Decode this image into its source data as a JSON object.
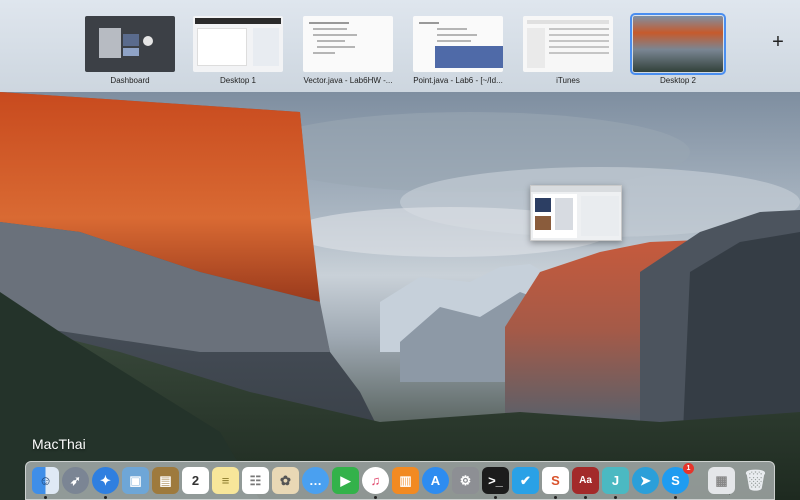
{
  "spaces": [
    {
      "label": "Dashboard"
    },
    {
      "label": "Desktop 1"
    },
    {
      "label": "Vector.java - Lab6HW -..."
    },
    {
      "label": "Point.java - Lab6 - [~/Id..."
    },
    {
      "label": "iTunes"
    },
    {
      "label": "Desktop 2"
    }
  ],
  "add_space_label": "+",
  "watermark": "MacThai",
  "calendar_day": "2",
  "skype_badge": "1",
  "dock_icons": [
    "finder-icon",
    "launchpad-icon",
    "safari-icon",
    "preview-icon",
    "notefile-icon",
    "calendar-icon",
    "notes-icon",
    "reminders-icon",
    "photo-icon",
    "messages-icon",
    "facetime-icon",
    "itunes-icon",
    "ibooks-icon",
    "app-store-icon",
    "system-preferences-icon",
    "terminal-icon",
    "twitter-icon",
    "slides-icon",
    "dictionary-icon",
    "stocks-icon",
    "telegram-icon",
    "skype-icon",
    "downloads-icon",
    "trash-icon"
  ]
}
